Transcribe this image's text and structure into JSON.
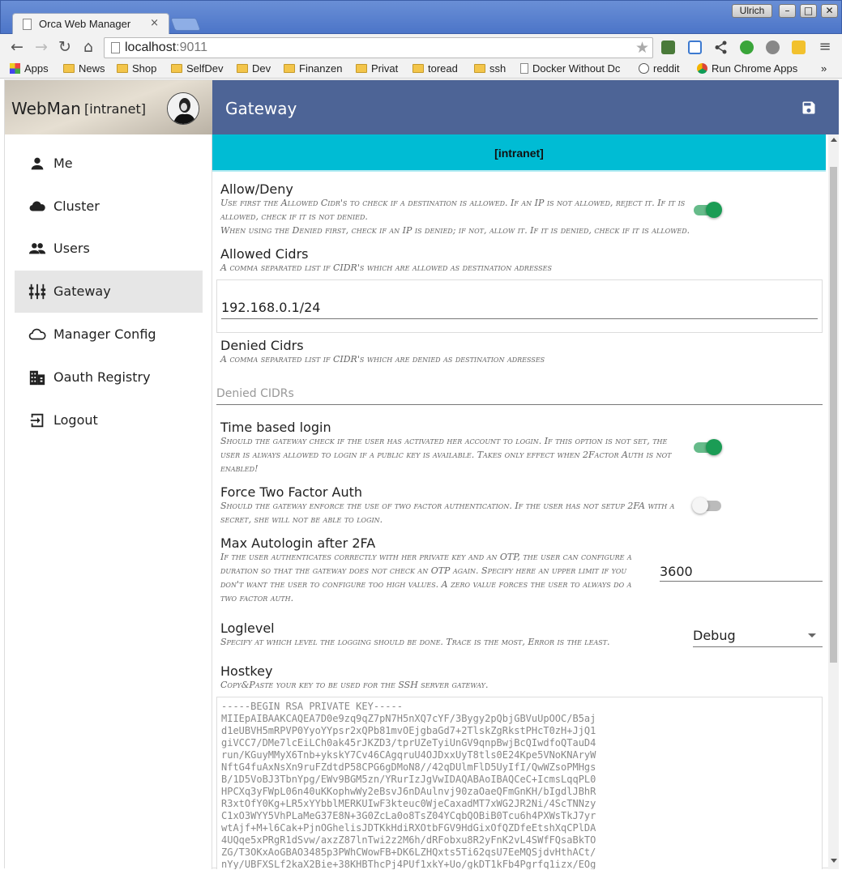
{
  "browser": {
    "tab_title": "Orca Web Manager",
    "tab_close": "×",
    "user_name": "Ulrich",
    "url_host": "localhost",
    "url_port": ":9011",
    "window_buttons": {
      "minimize": "–",
      "maximize": "□",
      "close": "✕"
    }
  },
  "bookmarks": [
    {
      "label": "Apps",
      "type": "apps"
    },
    {
      "label": "News",
      "type": "folder"
    },
    {
      "label": "Shop",
      "type": "folder"
    },
    {
      "label": "SelfDev",
      "type": "folder"
    },
    {
      "label": "Dev",
      "type": "folder"
    },
    {
      "label": "Finanzen",
      "type": "folder"
    },
    {
      "label": "Privat",
      "type": "folder"
    },
    {
      "label": "toread",
      "type": "folder"
    },
    {
      "label": "ssh",
      "type": "folder"
    },
    {
      "label": "Docker Without Dc",
      "type": "page"
    },
    {
      "label": "reddit",
      "type": "page"
    },
    {
      "label": "Run Chrome Apps",
      "type": "page"
    },
    {
      "label": "»",
      "type": "more"
    }
  ],
  "app": {
    "brand": "WebMan",
    "brand_context": "[intranet]",
    "page_title": "Gateway",
    "save_icon": "save-icon"
  },
  "sidebar": {
    "items": [
      {
        "label": "Me",
        "icon": "person-icon",
        "active": false
      },
      {
        "label": "Cluster",
        "icon": "cloud-icon",
        "active": false
      },
      {
        "label": "Users",
        "icon": "group-icon",
        "active": false
      },
      {
        "label": "Gateway",
        "icon": "tune-icon",
        "active": true
      },
      {
        "label": "Manager Config",
        "icon": "cloud-outline-icon",
        "active": false
      },
      {
        "label": "Oauth Registry",
        "icon": "building-icon",
        "active": false
      },
      {
        "label": "Logout",
        "icon": "exit-icon",
        "active": false
      }
    ]
  },
  "content": {
    "banner": "[intranet]",
    "allow_deny": {
      "title": "Allow/Deny",
      "desc1": "Use first the Allowed Cidr's to check if a destination is allowed. If an IP is not allowed, reject it. If it is allowed, check if it is not denied.",
      "desc2": "When using the Denied first, check if an IP is denied; if not, allow it. If it is denied, check if it is allowed.",
      "enabled": true
    },
    "allowed_cidrs": {
      "title": "Allowed Cidrs",
      "desc": "A comma separated list if CIDR's which are allowed as destination adresses",
      "value": "192.168.0.1/24"
    },
    "denied_cidrs": {
      "title": "Denied Cidrs",
      "desc": "A comma separated list if CIDR's which are denied as destination adresses",
      "placeholder": "Denied CIDRs"
    },
    "time_based_login": {
      "title": "Time based login",
      "desc": "Should the gateway check if the user has activated her account to login. If this option is not set, the user is always allowed to login if a public key is available. Takes only effect when 2Factor Auth is not enabled!",
      "enabled": true
    },
    "force_2fa": {
      "title": "Force Two Factor Auth",
      "desc": "Should the gateway enforce the use of two factor authentication. If the user has not setup 2FA with a secret, she will not be able to login.",
      "enabled": false
    },
    "max_autologin": {
      "title": "Max Autologin after 2FA",
      "desc": "If the user authenticates correctly with her private key and an OTP, the user can configure a duration so that the gateway does not check an OTP again. Specify here an upper limit if you don't want the user to configure too high values. A zero value forces the user to always do a two factor auth.",
      "value": "3600"
    },
    "loglevel": {
      "title": "Loglevel",
      "desc": "Specify at which level the logging should be done. Trace is the most, Error is the least.",
      "value": "Debug"
    },
    "hostkey": {
      "title": "Hostkey",
      "desc": "Copy&Paste your key to be used for the SSH server gateway.",
      "key_text": "-----BEGIN RSA PRIVATE KEY-----\nMIIEpAIBAAKCAQEA7D0e9zq9qZ7pN7H5nXQ7cYF/3Bygy2pQbjGBVuUpOOC/B5aj\nd1eUBVH5mRPVP0YyoYYpsr2xQPb81mvOEjgbaGd7+2TlskZgRkstPHcT0zH+JjQ1\ngiVCC7/DMe7lcEiLCh0ak45rJKZD3/tprUZeTyiUnGV9qnpBwjBcQIwdfoQTauD4\nrun/KGuyMMyX6Tnb+ykskY7Cv46CAgqruU4OJDxxUyT8tls0E24Kpe5VNoKNAryW\nNftG4fuAxNsXn9ruFZdtdP58CPG6gDMoN8//42qDUlmFlD5UyIfI/QwWZsoPMHgs\nB/1D5VoBJ3TbnYpg/EWv9BGM5zn/YRurIzJgVwIDAQABAoIBAQCeC+IcmsLqqPL0\nHPCXq3yFWpL06n40uKKophwWy2eBsvJ6nDAulnvj90zaOaeQFmGnKH/bIgdlJBhR\nR3xtOfY0Kg+LR5xYYbblMERKUIwF3kteuc0WjeCaxadMT7xWG2JR2Ni/4ScTNNzy\nC1xO3WYY5VhPLaMeG37E8N+3G0ZcLa0o8TsZ04YCqbQOBiB0Tcu6h4PXWsTkJ7yr\nwtAjf+M+l6Cak+PjnOGhelisJDTKkHdiRXOtbFGV9HdGixOfQZDfeEtshXqCPlDA\n4UQqe5xPRgR1dSvw/axzZ87lnTwi2z2M6h/dRFobxu8R2yFnK2vL4SWfFQsaBkTO\nZG/T3OKxAoGBAO3485p3PWhCWowFB+DK6LZHQxts5Ti62qsU7EeMQSjdvHthACt/\nnYy/UBFXSLf2kaX2Bie+38KHBThcPj4PUf1xkY+Uo/gkDT1kFb4Pgrfq1izx/EOg"
    }
  }
}
